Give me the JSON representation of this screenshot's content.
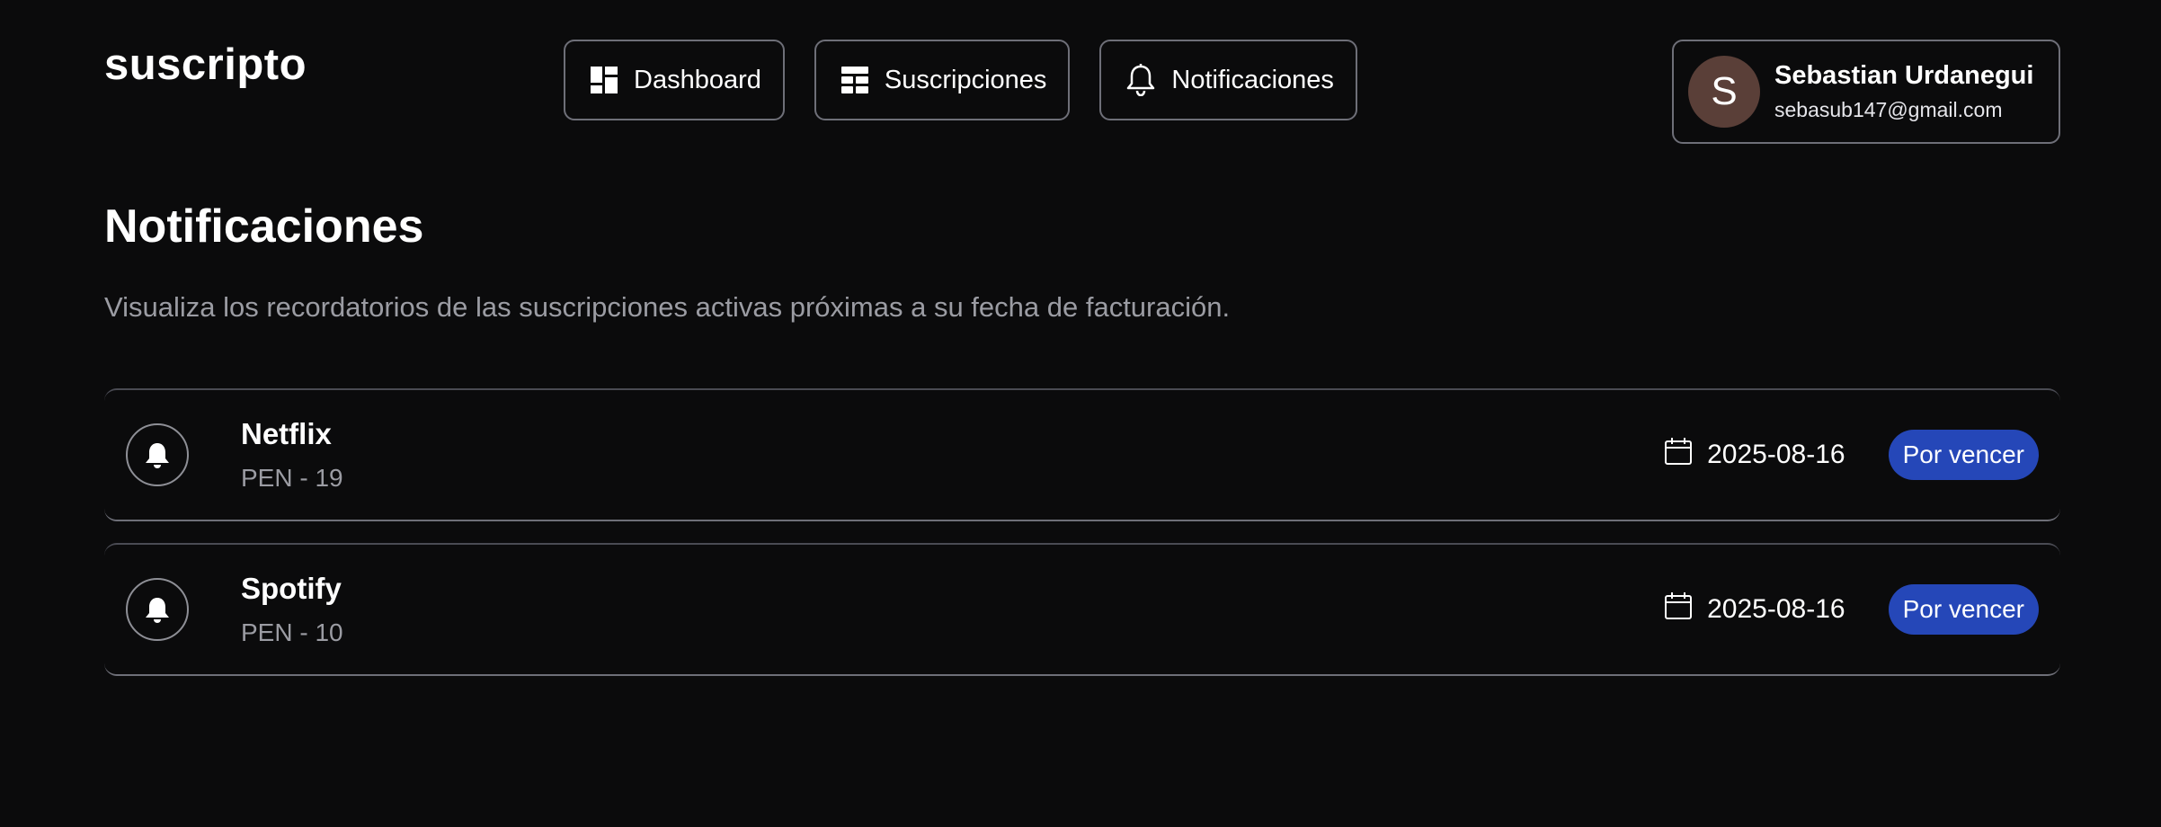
{
  "app": {
    "logo": "suscripto"
  },
  "nav": {
    "items": [
      {
        "label": "Dashboard",
        "icon": "dashboard-icon"
      },
      {
        "label": "Suscripciones",
        "icon": "table-icon"
      },
      {
        "label": "Notificaciones",
        "icon": "bell-icon"
      }
    ]
  },
  "user": {
    "initial": "S",
    "name": "Sebastian Urdanegui",
    "email": "sebasub147@gmail.com",
    "avatar_color": "#5a3f38"
  },
  "page": {
    "title": "Notificaciones",
    "subtitle": "Visualiza los recordatorios de las suscripciones activas próximas a su fecha de facturación."
  },
  "notifications": [
    {
      "name": "Netflix",
      "amount": "PEN - 19",
      "date": "2025-08-16",
      "status": "Por vencer"
    },
    {
      "name": "Spotify",
      "amount": "PEN - 10",
      "date": "2025-08-16",
      "status": "Por vencer"
    }
  ],
  "colors": {
    "background": "#0b0b0c",
    "badge": "#2547b8",
    "border": "#6e6f78",
    "muted_text": "#9b9ca3"
  }
}
